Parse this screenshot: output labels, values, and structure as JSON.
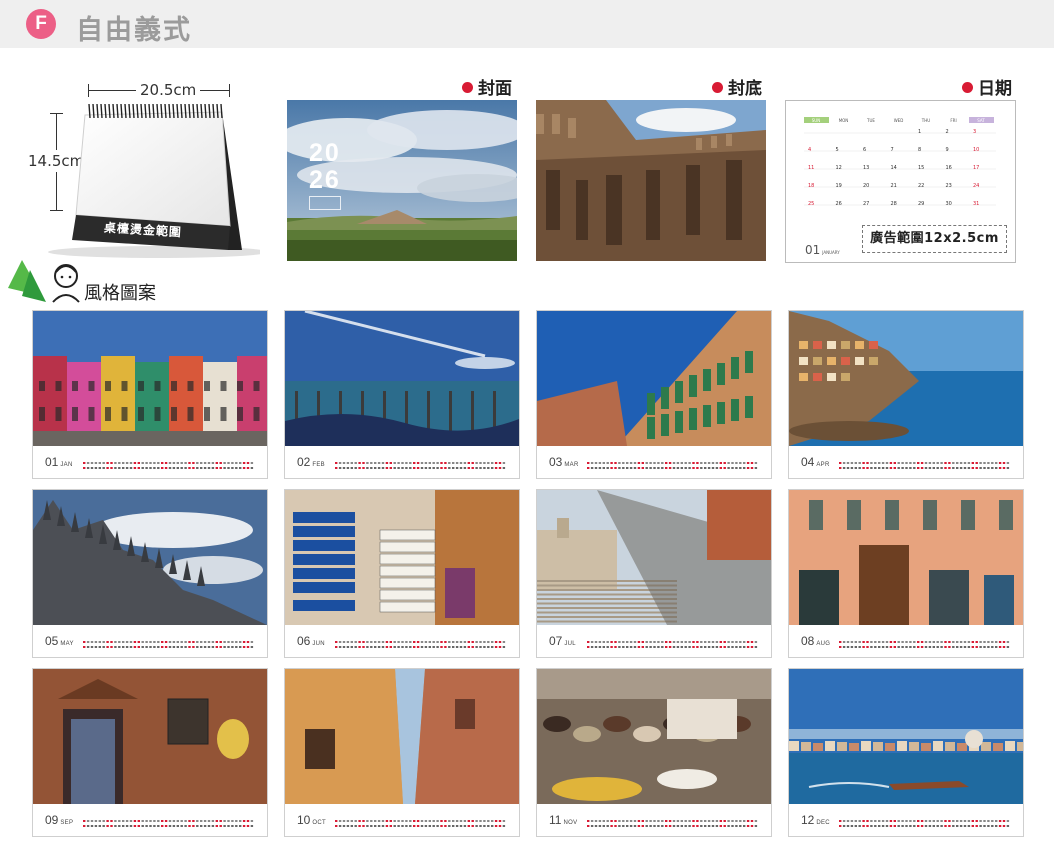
{
  "header": {
    "badge": "F",
    "title": "自由義式"
  },
  "mockup": {
    "width_label": "20.5cm",
    "height_label": "14.5cm",
    "base_label": "桌檯燙金範圍"
  },
  "top_row": {
    "cover": {
      "label": "封面",
      "year_line1": "20",
      "year_line2": "26"
    },
    "back": {
      "label": "封底"
    },
    "date": {
      "label": "日期",
      "weekdays": [
        "SUN",
        "MON",
        "TUE",
        "WED",
        "THU",
        "FRI",
        "SAT"
      ],
      "ad_text": "廣告範圍12x2.5cm",
      "month_number": "01",
      "month_name": "JANUARY"
    }
  },
  "style_section": {
    "label": "風格圖案"
  },
  "months": [
    {
      "num": "01",
      "abbr": "JAN",
      "scene": "burano-houses"
    },
    {
      "num": "02",
      "abbr": "FEB",
      "scene": "venice-gondolas"
    },
    {
      "num": "03",
      "abbr": "MAR",
      "scene": "street-buildings"
    },
    {
      "num": "04",
      "abbr": "APR",
      "scene": "cinque-terre-coast"
    },
    {
      "num": "05",
      "abbr": "MAY",
      "scene": "milan-cathedral"
    },
    {
      "num": "06",
      "abbr": "JUN",
      "scene": "street-signs"
    },
    {
      "num": "07",
      "abbr": "JUL",
      "scene": "spanish-steps"
    },
    {
      "num": "08",
      "abbr": "AUG",
      "scene": "orange-facade"
    },
    {
      "num": "09",
      "abbr": "SEP",
      "scene": "graffiti-door"
    },
    {
      "num": "10",
      "abbr": "OCT",
      "scene": "narrow-alley"
    },
    {
      "num": "11",
      "abbr": "NOV",
      "scene": "shoe-shop"
    },
    {
      "num": "12",
      "abbr": "DEC",
      "scene": "venice-lagoon"
    }
  ],
  "colors": {
    "badge": "#ec5f86",
    "dot": "#d81b34",
    "weekend": "#d81b34",
    "sun_header": "#a4d07c",
    "sat_header": "#c7b3dc"
  }
}
